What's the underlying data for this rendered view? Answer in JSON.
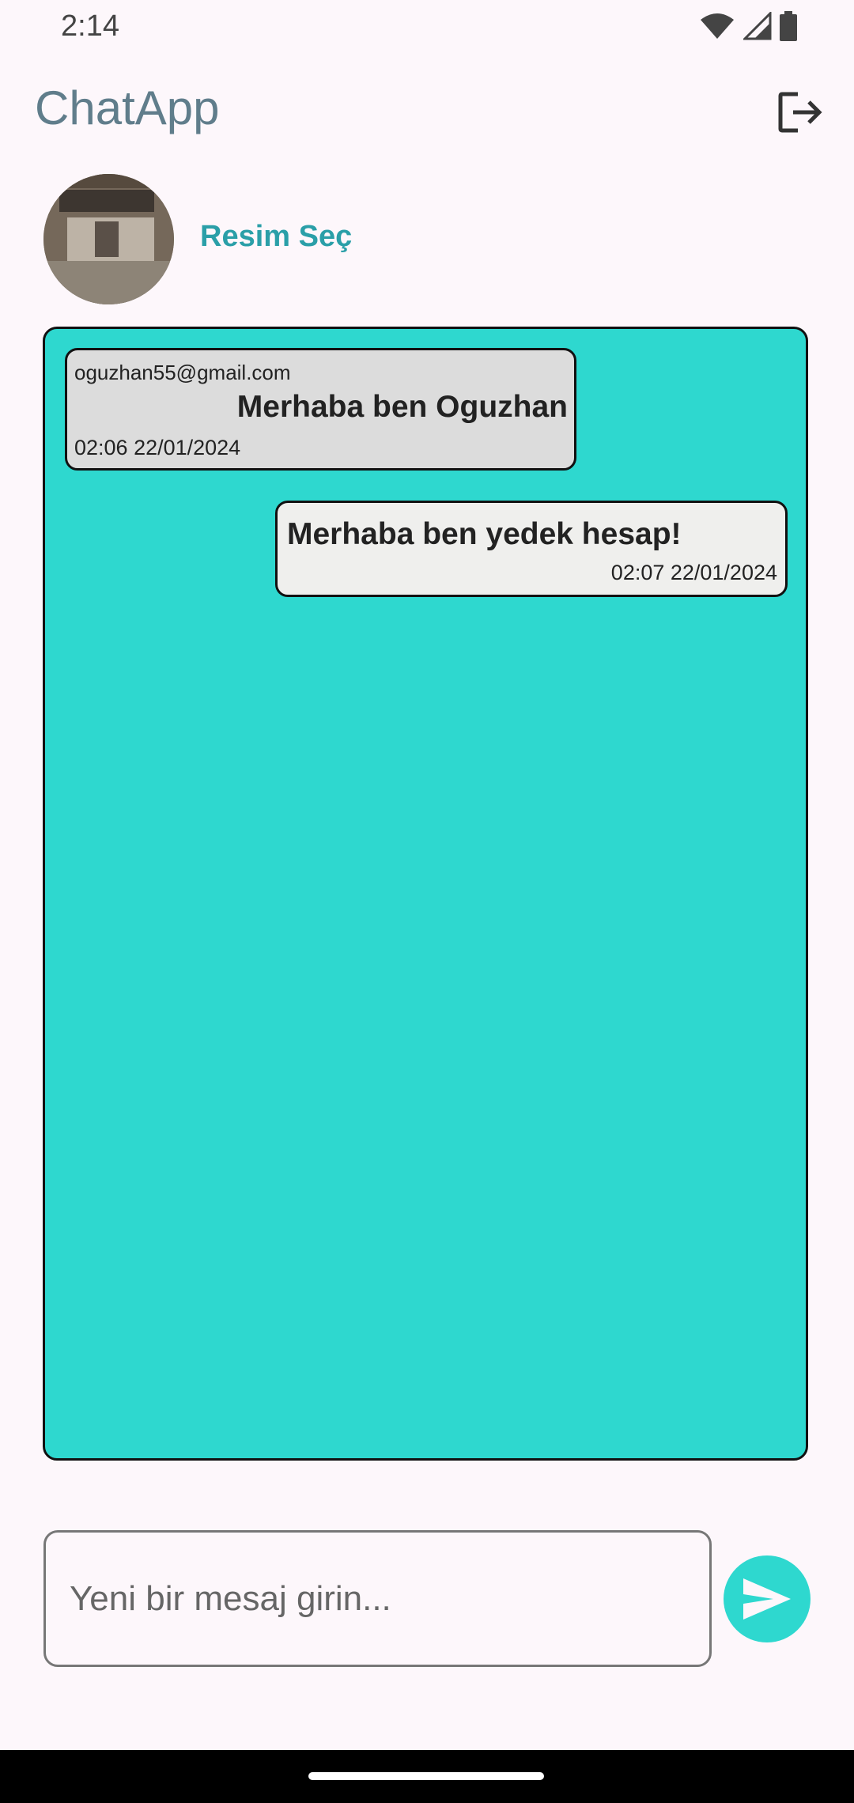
{
  "status_bar": {
    "time": "2:14",
    "icons": [
      "wifi-icon",
      "signal-icon",
      "battery-icon"
    ]
  },
  "app_bar": {
    "title": "ChatApp",
    "logout_icon": "logout-icon"
  },
  "profile": {
    "pick_image_label": "Resim Seç"
  },
  "messages": [
    {
      "direction": "incoming",
      "sender": "oguzhan55@gmail.com",
      "text": "Merhaba ben Oguzhan",
      "timestamp": "02:06 22/01/2024"
    },
    {
      "direction": "outgoing",
      "text": "Merhaba ben yedek hesap!",
      "timestamp": "02:07 22/01/2024"
    }
  ],
  "composer": {
    "placeholder": "Yeni bir mesaj girin...",
    "value": "",
    "send_icon": "send-icon"
  },
  "colors": {
    "accent": "#2ed8cf",
    "title": "#607d8b",
    "link": "#2a9fa8",
    "incoming_bubble": "#dcdcdc",
    "outgoing_bubble": "#efefed",
    "background": "#fdf7fb"
  }
}
